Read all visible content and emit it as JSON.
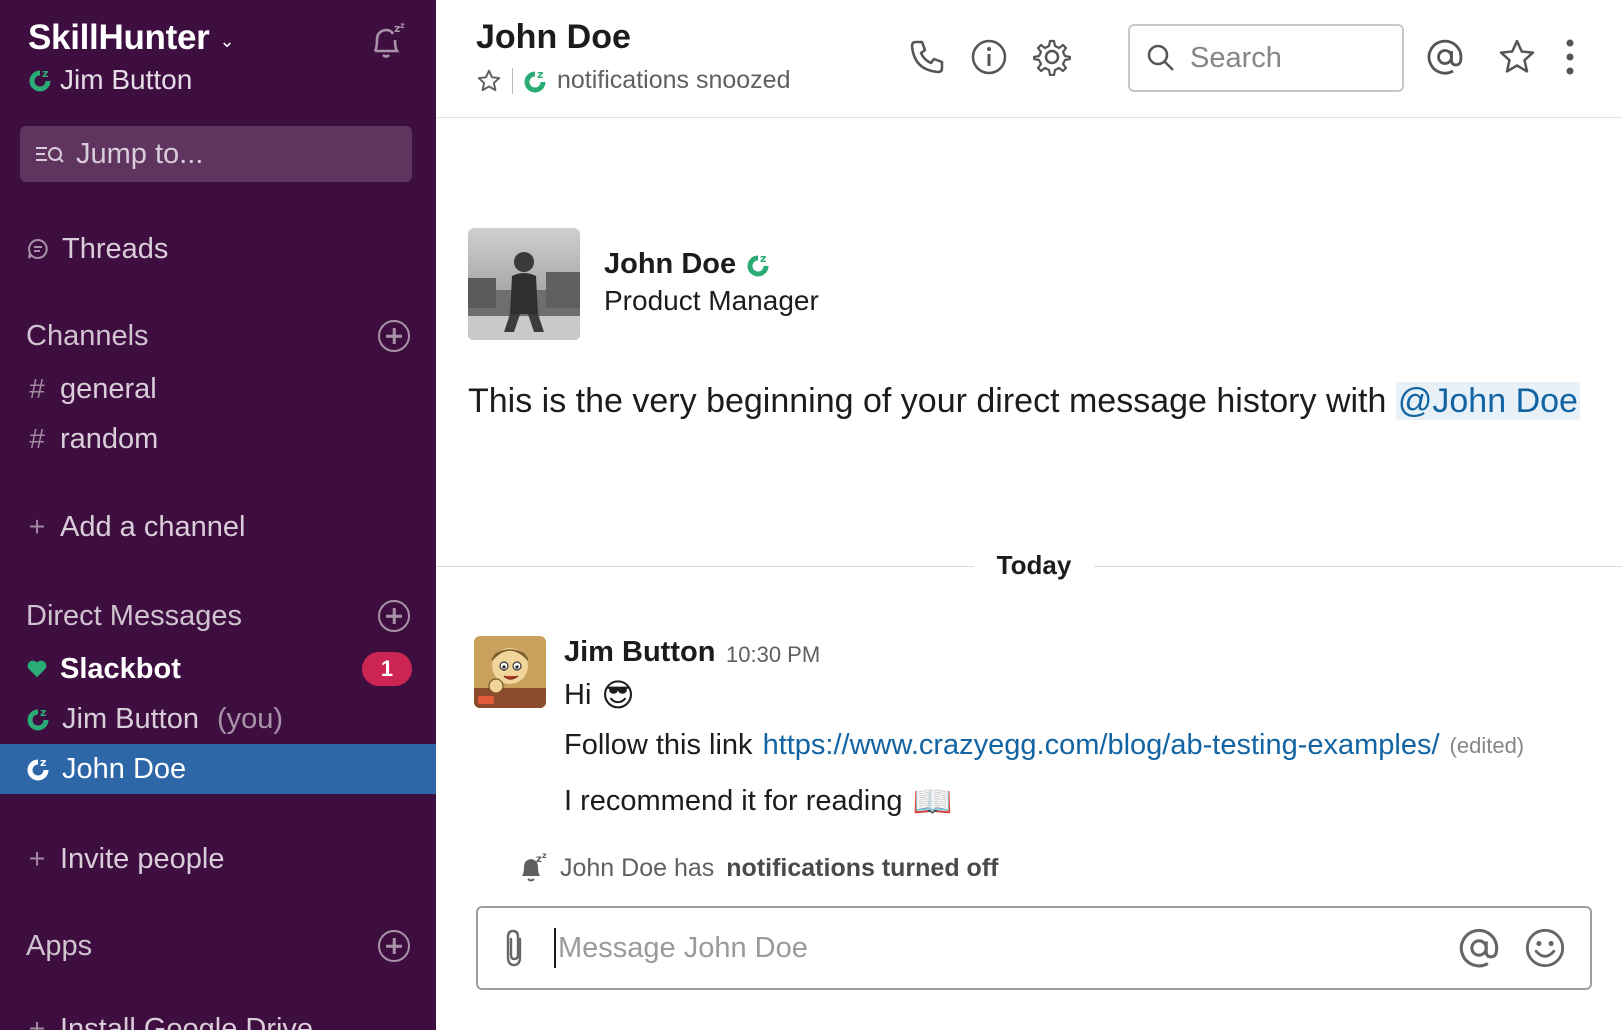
{
  "workspace": {
    "name": "SkillHunter",
    "chevron": "⌄",
    "user": "Jim Button"
  },
  "sidebar": {
    "jump_label": "Jump to...",
    "threads_label": "Threads",
    "channels_heading": "Channels",
    "channels": [
      {
        "prefix": "#",
        "name": "general"
      },
      {
        "prefix": "#",
        "name": "random"
      }
    ],
    "add_channel_prefix": "+",
    "add_channel": "Add a channel",
    "dm_heading": "Direct Messages",
    "dms": [
      {
        "name": "Slackbot",
        "badge": "1"
      },
      {
        "name": "Jim Button",
        "suffix": "(you)"
      },
      {
        "name": "John Doe"
      }
    ],
    "invite_prefix": "+",
    "invite": "Invite people",
    "apps_heading": "Apps",
    "partial_item": "Install Google Drive"
  },
  "header": {
    "title": "John Doe",
    "status": "notifications snoozed",
    "search_placeholder": "Search"
  },
  "profile": {
    "name": "John Doe",
    "role": "Product Manager"
  },
  "intro": {
    "text": "This is the very beginning of your direct message history with ",
    "mention": "@John Doe"
  },
  "divider": {
    "label": "Today"
  },
  "message": {
    "author": "Jim Button",
    "time": "10:30 PM",
    "line1": "Hi",
    "line1_emoji": "😎",
    "line2_prefix": "Follow this link",
    "line2_link": "https://www.crazyegg.com/blog/ab-testing-examples/",
    "line2_edited": "(edited)",
    "line3": "I recommend it for reading",
    "line3_emoji": "📖"
  },
  "system_note": {
    "prefix": "John Doe has",
    "bold": "notifications turned off"
  },
  "composer": {
    "placeholder": "Message John Doe"
  },
  "colors": {
    "sidebar_bg": "#3f0e40",
    "active_bg": "#2d67a8",
    "badge_bg": "#cd2553",
    "presence": "#2bac76",
    "link": "#1264a3"
  }
}
